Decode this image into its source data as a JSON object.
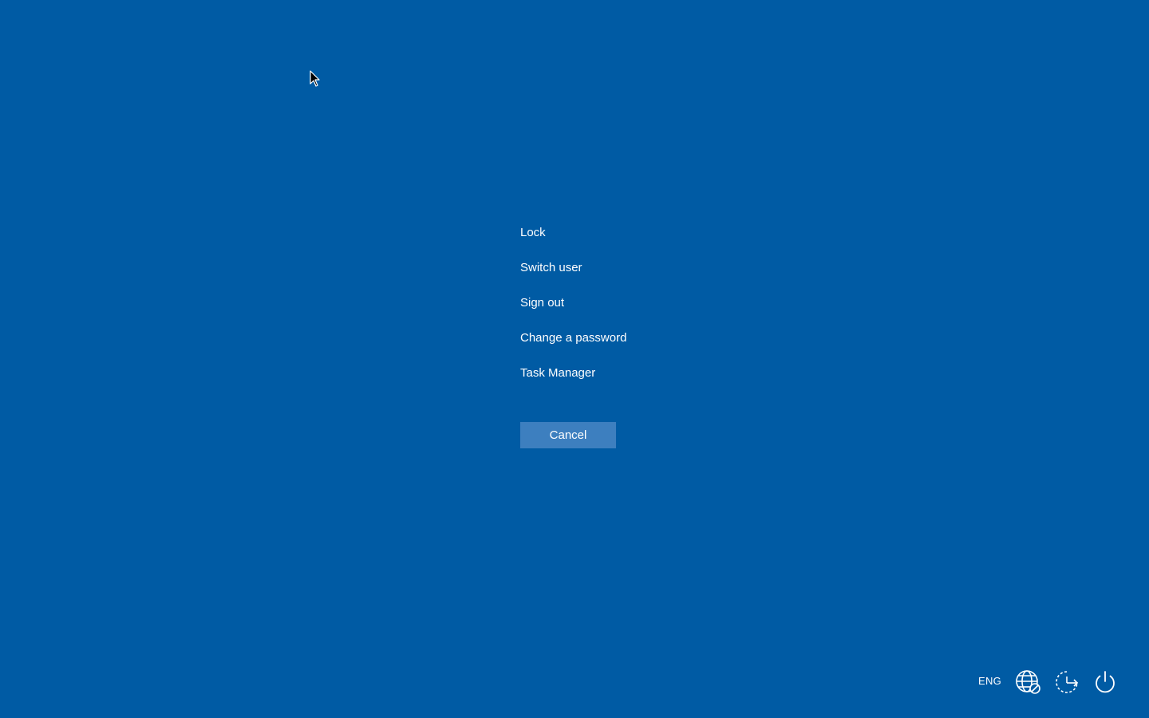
{
  "menu": {
    "items": [
      {
        "label": "Lock"
      },
      {
        "label": "Switch user"
      },
      {
        "label": "Sign out"
      },
      {
        "label": "Change a password"
      },
      {
        "label": "Task Manager"
      }
    ]
  },
  "cancel_label": "Cancel",
  "tray": {
    "language": "ENG",
    "icons": [
      "network-icon",
      "accessibility-icon",
      "power-icon"
    ]
  },
  "colors": {
    "background": "#005ba4",
    "button": "#3d7fbf",
    "text": "#ffffff"
  }
}
